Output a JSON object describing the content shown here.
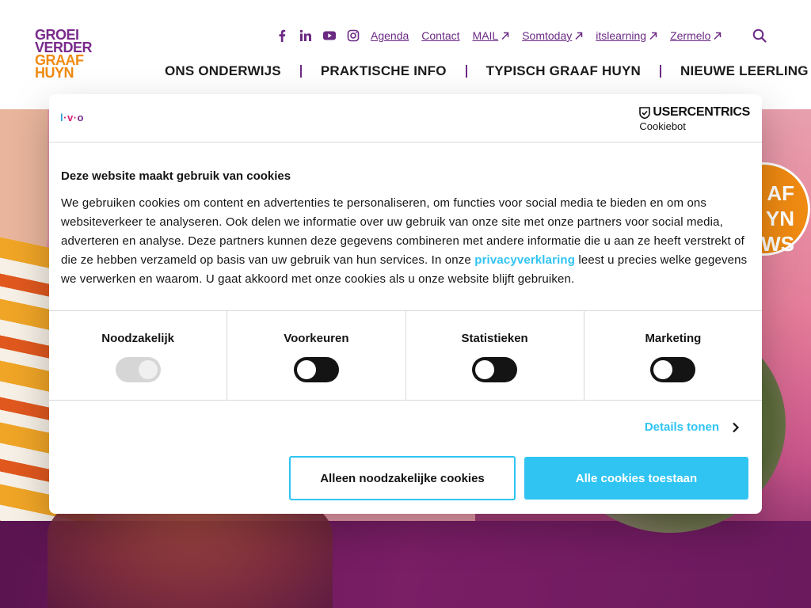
{
  "logo": {
    "line1": "GROEI",
    "line2": "VERDER",
    "line3": "GRAAF",
    "line4": "HUYN"
  },
  "social_icons": [
    "facebook-icon",
    "linkedin-icon",
    "youtube-icon",
    "instagram-icon"
  ],
  "toplinks": {
    "agenda": "Agenda",
    "contact": "Contact",
    "mail": "MAIL",
    "somtoday": "Somtoday",
    "itslearning": "itslearning",
    "zermelo": "Zermelo"
  },
  "mainnav": {
    "item1": "ONS ONDERWIJS",
    "item2": "PRAKTISCHE INFO",
    "item3": "TYPISCH GRAAF HUYN",
    "item4": "NIEUWE LEERLING"
  },
  "hero": {
    "badge_text": "AF\nYN\nWS"
  },
  "cookie": {
    "brand": {
      "a": "l",
      "b": "·v·",
      "c": "o"
    },
    "provider_name": "USERCENTRICS",
    "provider_sub": "Cookiebot",
    "title": "Deze website maakt gebruik van cookies",
    "text_before_link": "We gebruiken cookies om content en advertenties te personaliseren, om functies voor social media te bieden en om ons websiteverkeer te analyseren. Ook delen we informatie over uw gebruik van onze site met onze partners voor social media, adverteren en analyse. Deze partners kunnen deze gegevens combineren met andere informatie die u aan ze heeft verstrekt of die ze hebben verzameld op basis van uw gebruik van hun services. In onze ",
    "link": "privacyverklaring",
    "text_after_link": " leest u precies welke gegevens we verwerken en waarom. U gaat akkoord met onze cookies als u onze website blijft gebruiken.",
    "categories": [
      {
        "label": "Noodzakelijk",
        "state": "on-disabled"
      },
      {
        "label": "Voorkeuren",
        "state": "off"
      },
      {
        "label": "Statistieken",
        "state": "off"
      },
      {
        "label": "Marketing",
        "state": "off"
      }
    ],
    "details_label": "Details tonen",
    "btn_necessary": "Alleen noodzakelijke cookies",
    "btn_all": "Alle cookies toestaan"
  },
  "colors": {
    "accent": "#2fc4f2",
    "brand_purple": "#6b2a84",
    "brand_orange": "#ef8a12"
  }
}
